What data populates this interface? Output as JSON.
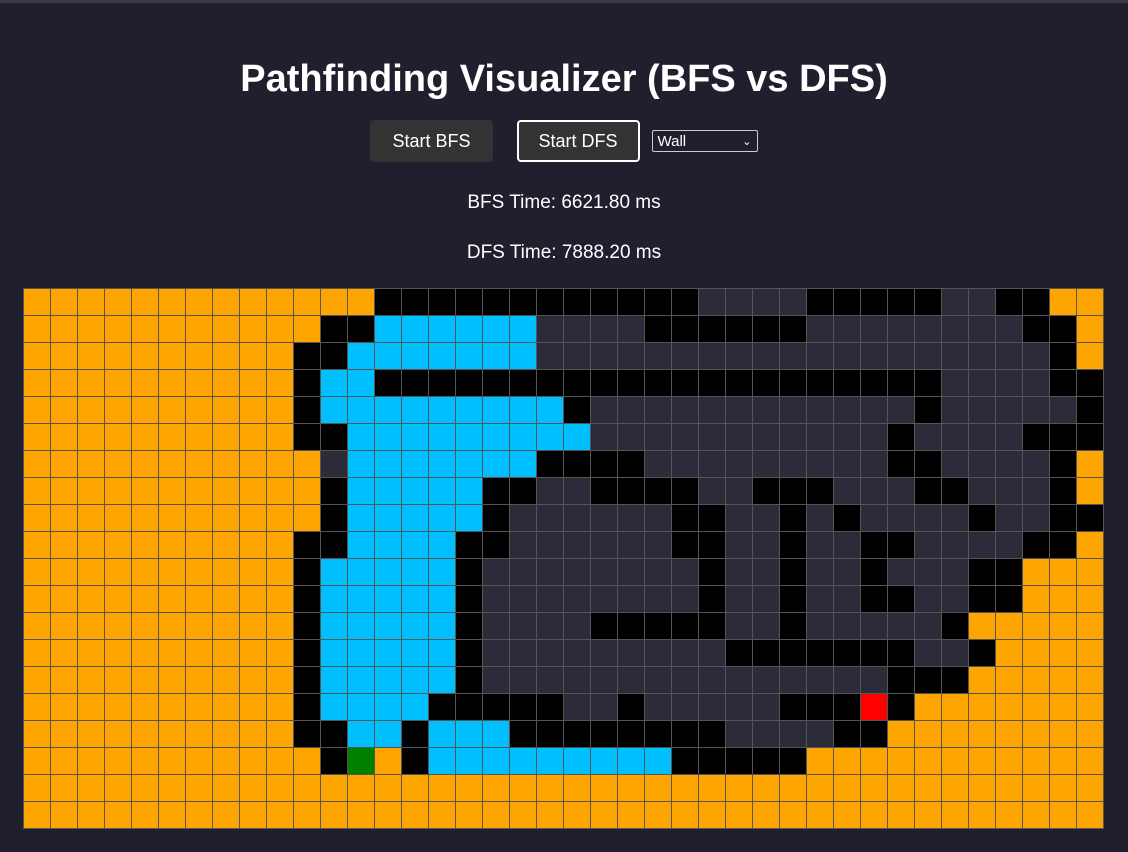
{
  "title": "Pathfinding Visualizer (BFS vs DFS)",
  "controls": {
    "start_bfs": "Start BFS",
    "start_dfs": "Start DFS",
    "mode_select": {
      "selected": "Wall"
    }
  },
  "times": {
    "bfs": "BFS Time: 6621.80 ms",
    "dfs": "DFS Time: 7888.20 ms"
  },
  "colors": {
    "background": "#1f1f2e",
    "wall": "#000000",
    "visited": "#ffa500",
    "path": "#00bfff",
    "start": "#008000",
    "end": "#ff0000"
  },
  "grid": {
    "cols": 40,
    "rows": 20,
    "legend": {
      "o": "visited",
      "w": "wall",
      "p": "path",
      "u": "unvisited",
      "s": "start",
      "e": "end"
    },
    "cells": [
      "ooooooooooooowwwwwwwwwwwwuuuuwwwwwuuwwoooo",
      "ooooooooooowwppppppuuuuwwwwwwuuuuuuuuwwoo",
      "oooooooooowwpppppppuuuuuuuuuuuuuuuuuuuwoo",
      "oooooooooowppwwwwwwwwwwwwwwwwwwwwwuuuuwwo",
      "oooooooooowpppppppppwuuuuuuuuuuuuwuuuuuwo",
      "oooooooooowwpppppppppuuuuuuuuuuuwuuuuwwwo",
      "oooooooooooupppppppwwwwuuuuuuuuuwwuuuuwo",
      "ooooooooooowpppppwwuuwwwwuuwwwuuuwwuuuwo",
      "ooooooooooowpppppwuuuuuuwwuuwuwuuuuwuuwwo",
      "oooooooooowwppppwwuuuuuuwwuuwuuwwuuuuwwoo",
      "oooooooooowpppppwuuuuuuuuwuuwuuwuuuwwooo",
      "oooooooooowpppppwuuuuuuuuwuuwuuwwuuwwooo",
      "oooooooooowpppppwuuuuwwwwwuuwuuuuuwoooo",
      "oooooooooowpppppwuuuuuuuuuwwwwwwwuuwoooo",
      "oooooooooowpppppwuuuuuuuuuuuuuuuwwwooooo",
      "oooooooooowppppwwwwwuuwuuuuuwwwewooooooo",
      "oooooooooowwppwpppwwwwwwwwuuuuwwoooooooo",
      "ooooooooooowsowpppppppppwwwwwoooooooooo",
      "oooooooooooooooooooooooooooooooooooooooo",
      "oooooooooooooooooooooooooooooooooooooooo"
    ]
  }
}
